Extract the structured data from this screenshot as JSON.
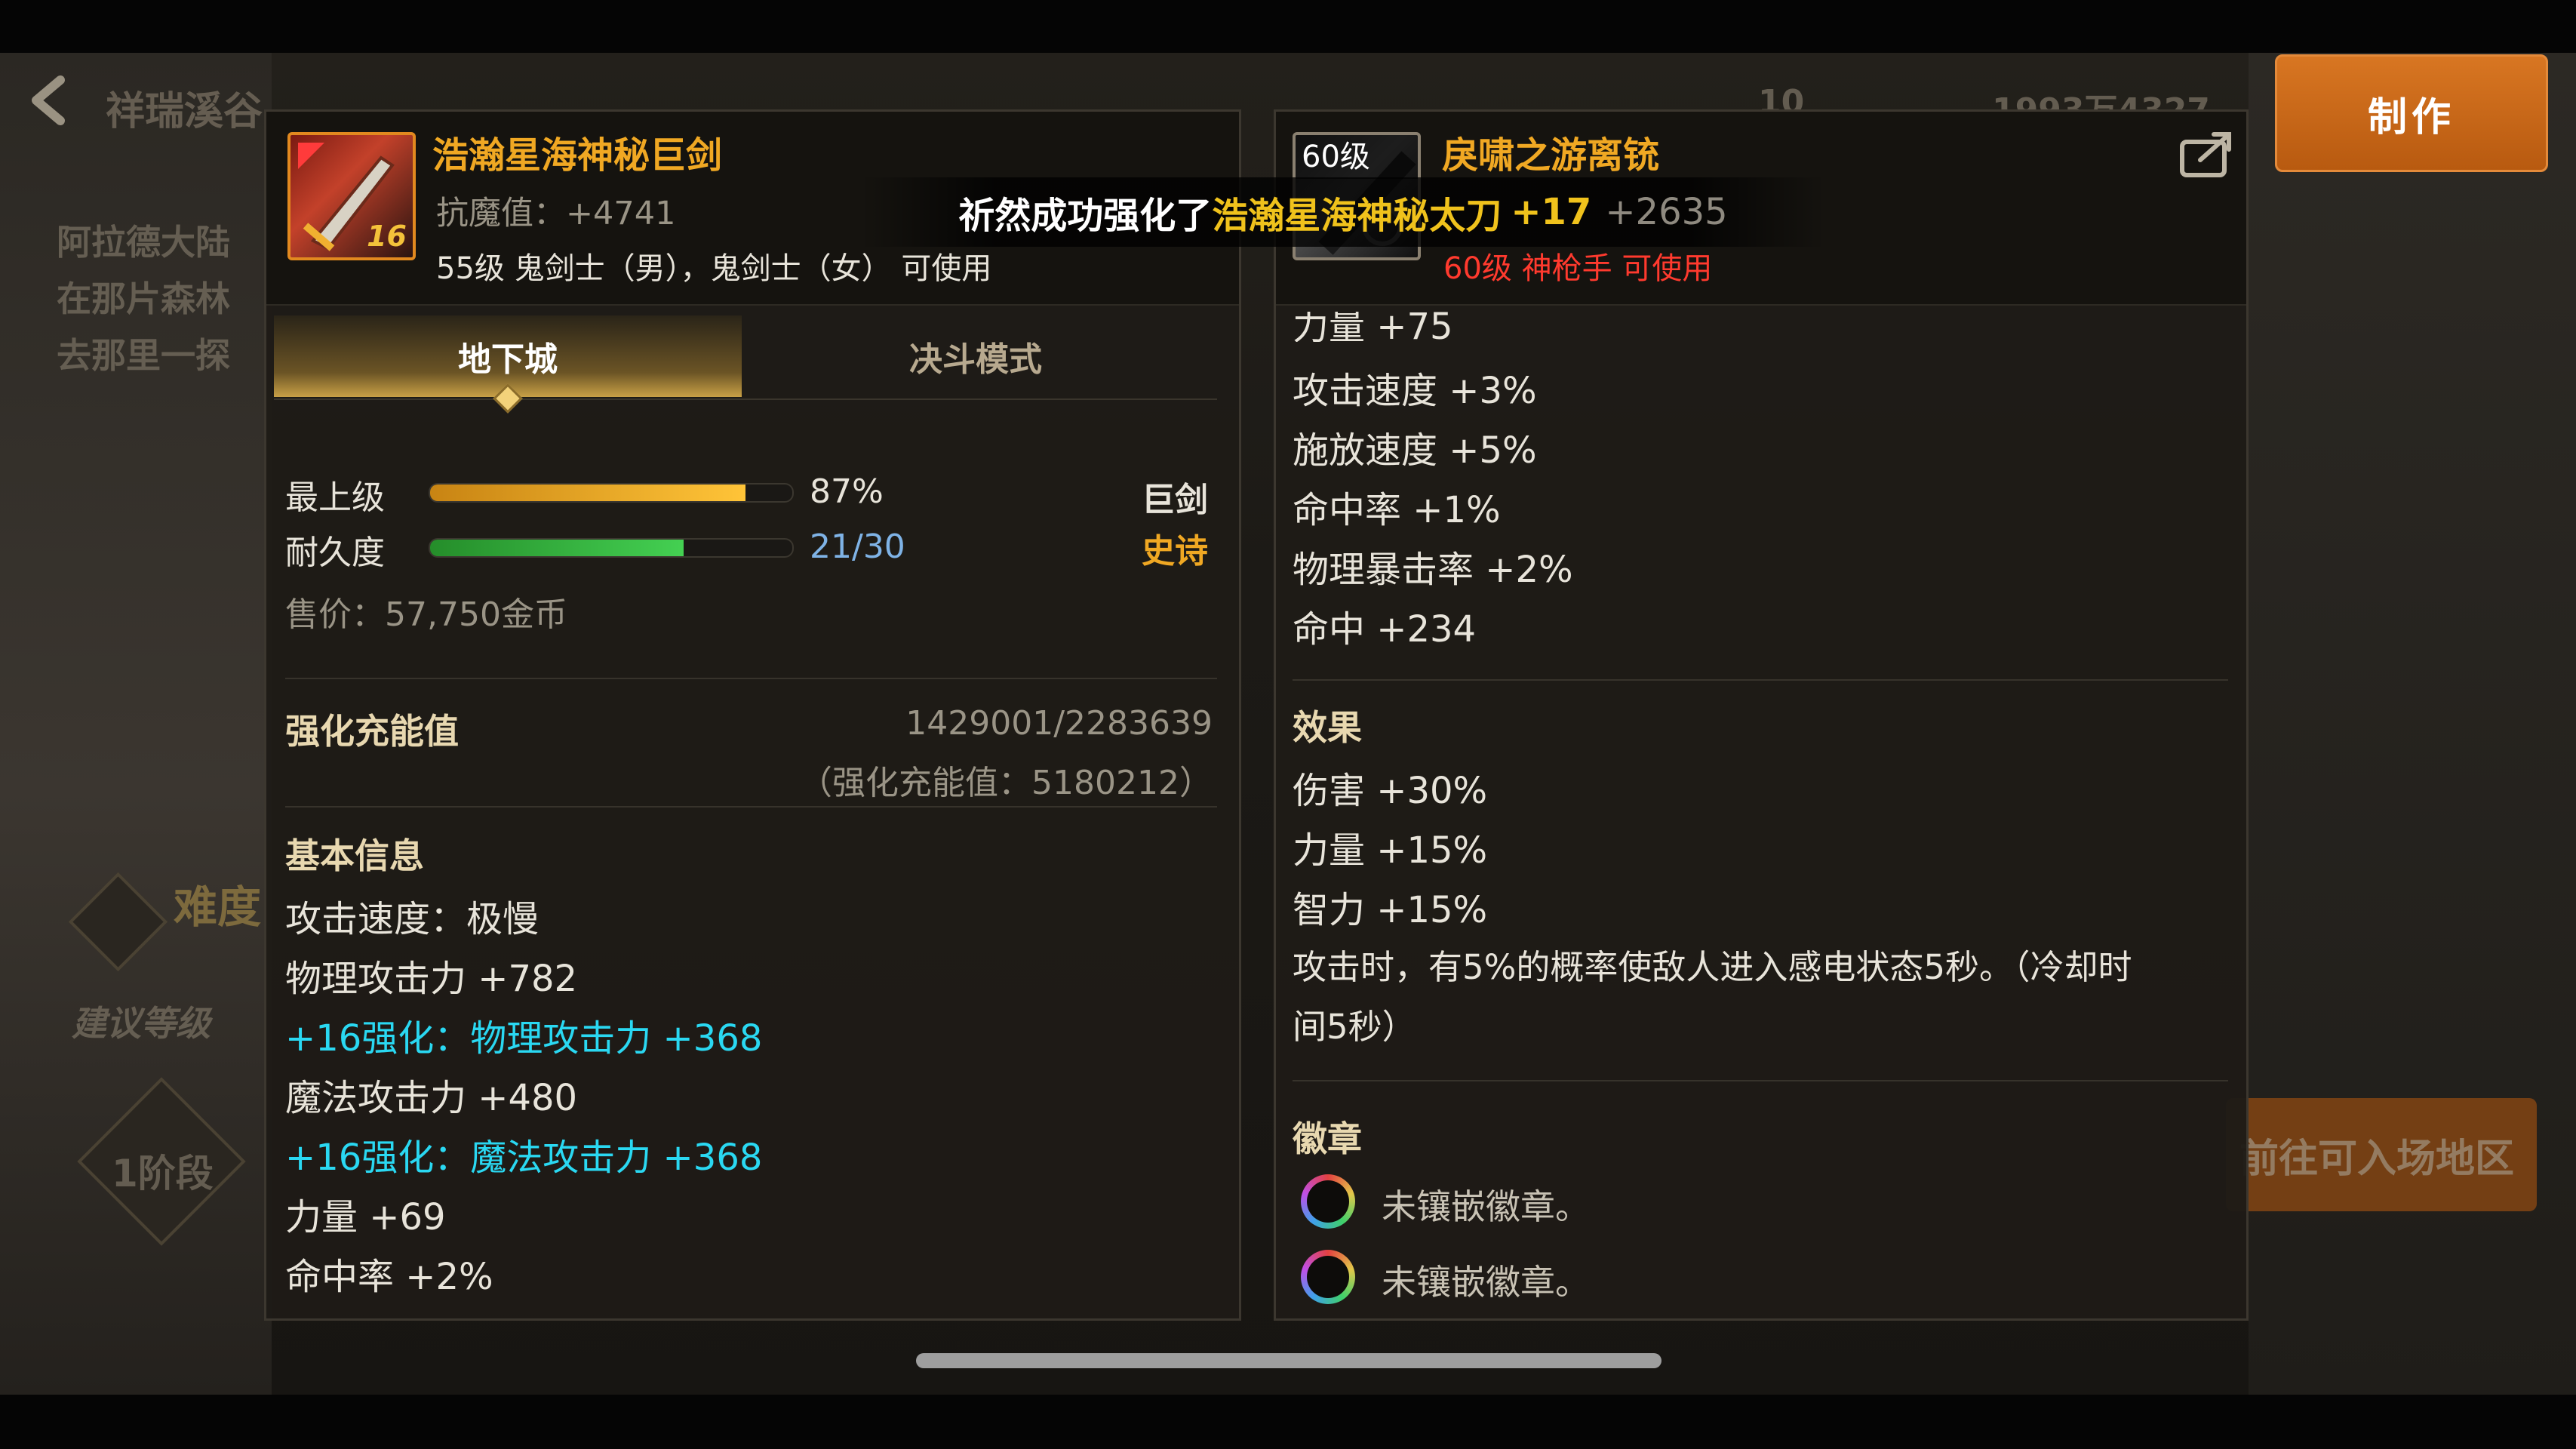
{
  "background": {
    "location_title": "祥瑞溪谷",
    "top_counter": "10",
    "top_coins": "1993万4327",
    "description_lines": [
      "阿拉德大陆",
      "在那片森林",
      "去那里一探"
    ],
    "difficulty_label": "难度",
    "recommended_level_label": "建议等级",
    "stage_label": "1阶段",
    "travel_button": "前往可入场地区",
    "make_button": "制作"
  },
  "toast": {
    "prefix": "祈然成功强化了",
    "item": "浩瀚星海神秘太刀",
    "level": "+17",
    "extra": "+2635"
  },
  "left_item": {
    "name": "浩瀚星海神秘巨剑",
    "icon_level": "16",
    "anti_magic": "抗魔值：+4741",
    "requirement": "55级 鬼剑士（男），鬼剑士（女） 可使用",
    "tabs": [
      "地下城",
      "决斗模式"
    ],
    "grade_label": "最上级",
    "grade_percent": 87,
    "grade_value": "87%",
    "durability_label": "耐久度",
    "durability_current": 21,
    "durability_max": 30,
    "durability_value": "21/30",
    "weapon_type": "巨剑",
    "rarity": "史诗",
    "price": "售价：57,750金币",
    "charge_label": "强化充能值",
    "charge_value": "1429001/2283639",
    "charge_total": "（强化充能值：5180212）",
    "basic_info_title": "基本信息",
    "stats": [
      "攻击速度：极慢",
      "物理攻击力 +782",
      "+16强化：物理攻击力 +368",
      "魔法攻击力 +480",
      "+16强化：魔法攻击力 +368",
      "力量 +69",
      "命中率 +2%"
    ]
  },
  "right_item": {
    "name": "戾啸之游离铳",
    "level_tag": "60级",
    "requirement": "60级 神枪手 可使用",
    "partial_stat": "力量 +75",
    "stats": [
      "攻击速度 +3%",
      "施放速度 +5%",
      "命中率 +1%",
      "物理暴击率 +2%",
      "命中 +234"
    ],
    "effects_title": "效果",
    "effects": [
      "伤害 +30%",
      "力量 +15%",
      "智力 +15%"
    ],
    "effect_desc_1": "攻击时，有5%的概率使敌人进入感电状态5秒。（冷却时",
    "effect_desc_2": "间5秒）",
    "emblem_title": "徽章",
    "emblems": [
      "未镶嵌徽章。",
      "未镶嵌徽章。"
    ]
  },
  "colors": {
    "item_name": "#f0a823",
    "enhance_stat": "#2ad8f2",
    "requirement_unusable": "#ff3a2e",
    "accent_button": "#c9681a"
  }
}
